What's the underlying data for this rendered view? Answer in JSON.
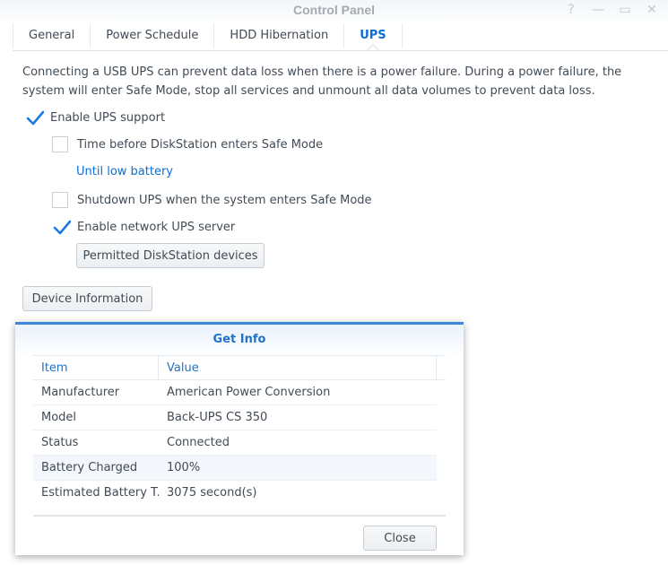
{
  "window": {
    "title": "Control Panel",
    "controls": [
      {
        "name": "help-icon",
        "glyph": "?"
      },
      {
        "name": "minimize-icon",
        "glyph": "—"
      },
      {
        "name": "maximize-icon",
        "glyph": "▭"
      },
      {
        "name": "close-icon",
        "glyph": "✕"
      }
    ]
  },
  "tabs": [
    {
      "label": "General",
      "active": false
    },
    {
      "label": "Power Schedule",
      "active": false
    },
    {
      "label": "HDD Hibernation",
      "active": false
    },
    {
      "label": "UPS",
      "active": true
    }
  ],
  "ups": {
    "description": "Connecting a USB UPS can prevent data loss when there is a power failure. During a power failure, the system will enter Safe Mode, stop all services and unmount all data volumes to prevent data loss.",
    "enable_ups": {
      "label": "Enable UPS support",
      "checked": true
    },
    "time_before_safe_mode": {
      "label": "Time before DiskStation enters Safe Mode",
      "checked": false
    },
    "until_low_battery": "Until low battery",
    "shutdown_ups": {
      "label": "Shutdown UPS when the system enters Safe Mode",
      "checked": false
    },
    "network_ups": {
      "label": "Enable network UPS server",
      "checked": true
    },
    "permitted_button": "Permitted DiskStation devices",
    "device_info_button": "Device Information"
  },
  "dialog": {
    "title": "Get Info",
    "columns": [
      "Item",
      "Value"
    ],
    "rows": [
      {
        "item": "Manufacturer",
        "value": "American Power Conversion"
      },
      {
        "item": "Model",
        "value": "Back-UPS CS 350"
      },
      {
        "item": "Status",
        "value": "Connected"
      },
      {
        "item": "Battery Charged",
        "value": "100%"
      },
      {
        "item": "Estimated Battery T...",
        "value": "3075 second(s)"
      }
    ],
    "close_button": "Close"
  },
  "colors": {
    "accent": "#0b6ed3",
    "dialog_border": "#3a87d9"
  }
}
